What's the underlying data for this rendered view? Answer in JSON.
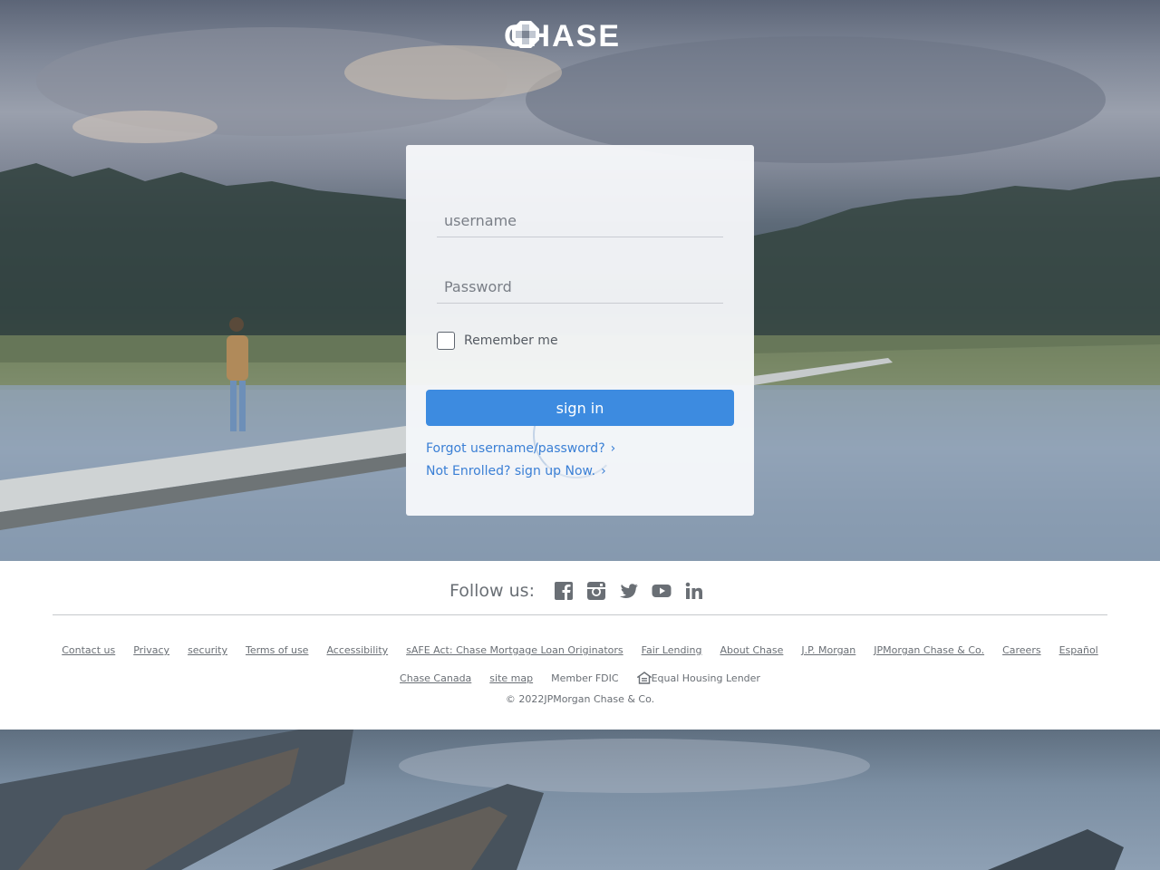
{
  "brand": {
    "name": "CHASE",
    "logo_icon": "chase-octagon-icon"
  },
  "login": {
    "username_placeholder": "username",
    "password_placeholder": "Password",
    "remember_label": "Remember me",
    "signin_label": "sign in",
    "forgot_link": "Forgot username/password?",
    "enroll_link": "Not Enrolled? sign up Now.",
    "chevron": "›"
  },
  "footer": {
    "follow_label": "Follow us:",
    "social": [
      "facebook-icon",
      "instagram-icon",
      "twitter-icon",
      "youtube-icon",
      "linkedin-icon"
    ],
    "links_row1": [
      "Contact us",
      "Privacy",
      "security",
      "Terms of use",
      "Accessibility",
      "sAFE Act: Chase Mortgage Loan Originators",
      "Fair Lending",
      "About Chase",
      "J.P. Morgan",
      "JPMorgan Chase & Co.",
      "Careers",
      "Español"
    ],
    "links_row2": {
      "chase_canada": "Chase Canada",
      "site_map": "site map",
      "member_fdic": "Member FDIC",
      "equal_housing": "Equal Housing Lender"
    },
    "copyright": "© 2022JPMorgan Chase & Co."
  },
  "colors": {
    "accent": "#3d8be0",
    "link": "#3a7fd5",
    "footer_text": "#6a6f75"
  }
}
